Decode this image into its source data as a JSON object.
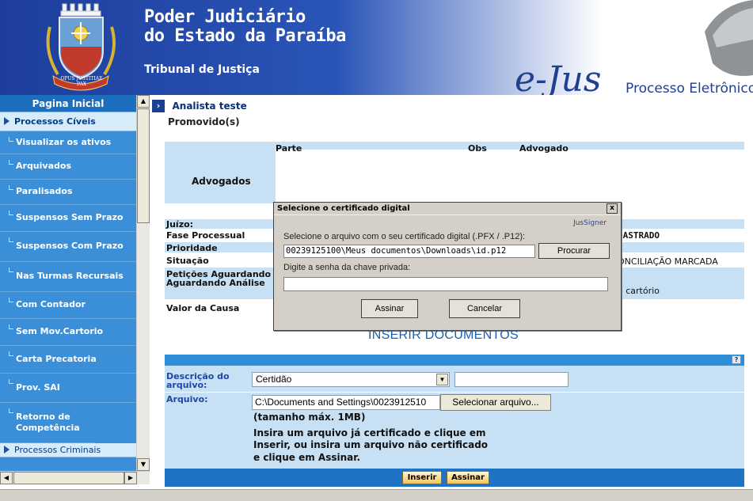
{
  "header": {
    "title_line1": "Poder Judiciário",
    "title_line2": "do Estado da Paraíba",
    "subtitle": "Tribunal de Justiça",
    "logo_text": "e-Jus",
    "logo_sub": "Processo Eletrônico",
    "crest_lettering": "OPUS JUSTITIAE PAX"
  },
  "sidebar": {
    "home_label": "Pagina Inicial",
    "section_civeis": "Processos Cíveis",
    "items": [
      "Visualizar os ativos",
      "Arquivados",
      "Paralisados",
      "Suspensos Sem Prazo",
      "Suspensos Com Prazo",
      "Nas Turmas Recursais",
      "Com Contador",
      "Sem Mov.Cartorio",
      "Carta Precatoria",
      "Prov. SAI",
      "Retorno de Competência"
    ],
    "section_criminais": "Processos Criminais"
  },
  "main": {
    "user_name": "Analista teste",
    "clipped_heading": "Promovido(s)",
    "advogados": {
      "label": "Advogados",
      "col_parte": "Parte",
      "col_obs": "Obs",
      "col_advogado": "Advogado"
    },
    "fields": {
      "juizo": "Juízo:",
      "fase": "Fase Processual",
      "prioridade": "Prioridade",
      "situacao": "Situação",
      "peticoes": "Petições Aguardando Aguardando Análise",
      "valor": "Valor da Causa"
    },
    "values_right": {
      "fase": "DASTRADO",
      "situacao": "ONCILIAÇÃO MARCADA",
      "peticoes": "o cartório"
    },
    "inserir_title": "INSERIR DOCUMENTOS",
    "upload": {
      "desc_label": "Descrição do arquivo:",
      "desc_value": "Certidão",
      "arquivo_label": "Arquivo:",
      "file_path": "C:\\Documents and Settings\\0023912510",
      "select_file_btn": "Selecionar arquivo...",
      "hint_lines": [
        "(tamanho máx. 1MB)",
        "Insira um arquivo já certificado e clique em",
        "Inserir, ou insira um arquivo não certificado",
        "e clique em Assinar."
      ],
      "btn_inserir": "Inserir",
      "btn_assinar": "Assinar"
    }
  },
  "dialog": {
    "title": "Selecione o certificado digital",
    "close": "x",
    "brand": "JusSigner",
    "prompt_file": "Selecione o arquivo com o seu certificado digital (.PFX / .P12):",
    "file_path": "00239125100\\Meus documentos\\Downloads\\id.p12",
    "browse_btn": "Procurar",
    "prompt_password": "Digite a senha da chave privada:",
    "password_value": "",
    "btn_sign": "Assinar",
    "btn_cancel": "Cancelar"
  }
}
